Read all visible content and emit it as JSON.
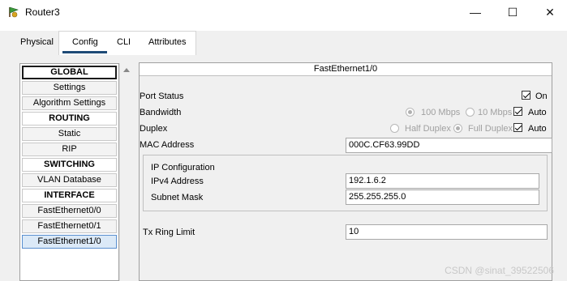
{
  "window": {
    "title": "Router3",
    "minimize": "—",
    "maximize": "☐",
    "close": "✕"
  },
  "tabs": [
    {
      "label": "Physical"
    },
    {
      "label": "Config"
    },
    {
      "label": "CLI"
    },
    {
      "label": "Attributes"
    }
  ],
  "sidebar": {
    "items": [
      {
        "label": "GLOBAL"
      },
      {
        "label": "Settings"
      },
      {
        "label": "Algorithm Settings"
      },
      {
        "label": "ROUTING"
      },
      {
        "label": "Static"
      },
      {
        "label": "RIP"
      },
      {
        "label": "SWITCHING"
      },
      {
        "label": "VLAN Database"
      },
      {
        "label": "INTERFACE"
      },
      {
        "label": "FastEthernet0/0"
      },
      {
        "label": "FastEthernet0/1"
      },
      {
        "label": "FastEthernet1/0"
      }
    ]
  },
  "panel": {
    "title": "FastEthernet1/0",
    "port_status": {
      "label": "Port Status",
      "on_label": "On",
      "checked": true
    },
    "bandwidth": {
      "label": "Bandwidth",
      "opt1": "100 Mbps",
      "opt2": "10 Mbps",
      "auto_label": "Auto",
      "auto_checked": true
    },
    "duplex": {
      "label": "Duplex",
      "opt1": "Half Duplex",
      "opt2": "Full Duplex",
      "auto_label": "Auto",
      "auto_checked": true
    },
    "mac": {
      "label": "MAC Address",
      "value": "000C.CF63.99DD"
    },
    "ip_config": {
      "title": "IP Configuration",
      "ipv4": {
        "label": "IPv4 Address",
        "value": "192.1.6.2"
      },
      "mask": {
        "label": "Subnet Mask",
        "value": "255.255.255.0"
      }
    },
    "tx_ring": {
      "label": "Tx Ring Limit",
      "value": "10"
    }
  },
  "watermark": "CSDN @sinat_39522506",
  "colors": {
    "accent": "#1e4b77",
    "selected_bg": "#dbe9f7"
  }
}
